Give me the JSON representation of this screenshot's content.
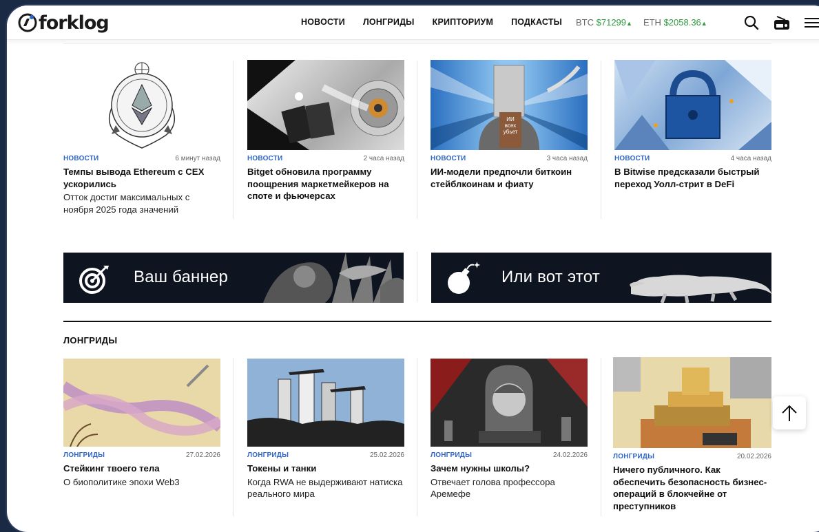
{
  "header": {
    "logo_text": "forklog",
    "nav": [
      "НОВОСТИ",
      "ЛОНГРИДЫ",
      "КРИПТОРИУМ",
      "ПОДКАСТЫ"
    ],
    "tickers": [
      {
        "symbol": "BTC",
        "price": "$71299",
        "arrow": "▲"
      },
      {
        "symbol": "ETH",
        "price": "$2058.36",
        "arrow": "▲"
      }
    ],
    "icons": [
      "search-icon",
      "radio-icon",
      "menu-icon"
    ]
  },
  "news": [
    {
      "category": "НОВОСТИ",
      "time": "6 минут назад",
      "title": "Темпы вывода Ethereum с CEX ускорились",
      "subtitle": "Отток достиг максимальных с ноября 2025 года значений"
    },
    {
      "category": "НОВОСТИ",
      "time": "2 часа назад",
      "title": "Bitget обновила программу поощрения маркетмейкеров на споте и фьючерсах",
      "subtitle": ""
    },
    {
      "category": "НОВОСТИ",
      "time": "3 часа назад",
      "title": "ИИ-модели предпочли биткоин стейблкоинам и фиату",
      "subtitle": ""
    },
    {
      "category": "НОВОСТИ",
      "time": "4 часа назад",
      "title": "В Bitwise предсказали быстрый переход Уолл-стрит в DeFi",
      "subtitle": ""
    }
  ],
  "image_texts": {
    "ai_sign": "ИИ всех убьет"
  },
  "banners": [
    {
      "text": "Ваш баннер",
      "icon": "target-icon"
    },
    {
      "text": "Или вот этот",
      "icon": "bomb-icon"
    }
  ],
  "longreads_section": {
    "title": "ЛОНГРИДЫ",
    "items": [
      {
        "category": "ЛОНГРИДЫ",
        "date": "27.02.2026",
        "title": "Стейкинг твоего тела",
        "subtitle": "О биополитике эпохи Web3"
      },
      {
        "category": "ЛОНГРИДЫ",
        "date": "25.02.2026",
        "title": "Токены и танки",
        "subtitle": "Когда RWA не выдерживают натиска реального мира"
      },
      {
        "category": "ЛОНГРИДЫ",
        "date": "24.02.2026",
        "title": "Зачем нужны школы?",
        "subtitle": "Отвечает голова профессора Аремефе"
      },
      {
        "category": "ЛОНГРИДЫ",
        "date": "20.02.2026",
        "title": "Ничего публичного. Как обеспечить безопасность бизнес-операций в блокчейне от преступников",
        "subtitle": ""
      }
    ]
  },
  "colors": {
    "accent": "#2f66c7",
    "ticker_up": "#2e9a3c",
    "banner_bg": "#0e1420"
  }
}
